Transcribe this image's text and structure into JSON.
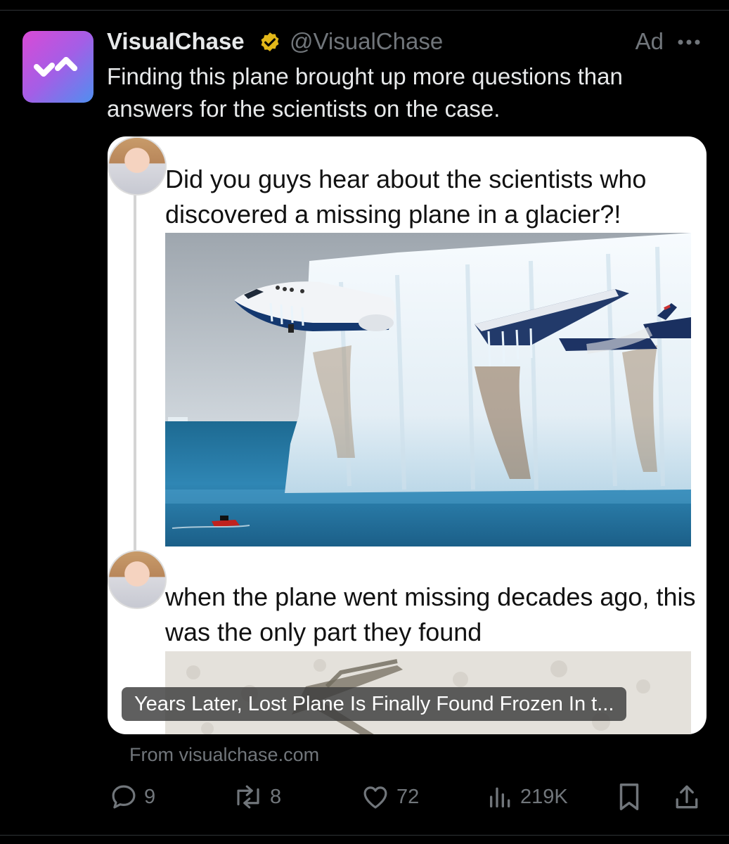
{
  "author": {
    "name": "VisualChase",
    "handle": "@VisualChase",
    "verified": true,
    "brand_gradient": [
      "#d94ad6",
      "#a45ee6",
      "#4f8ff0"
    ]
  },
  "ad_label": "Ad",
  "tweet": {
    "text": "Finding this plane brought up more questions than answers for the scientists on the case."
  },
  "card": {
    "post1_text": "Did you guys hear about the scientists who discovered a missing plane in a glacier?!",
    "post2_text": "when the plane went missing decades ago, this was the only part they found",
    "caption": "Years Later, Lost Plane Is Finally Found Frozen In t...",
    "source": "From visualchase.com"
  },
  "actions": {
    "replies": "9",
    "reposts": "8",
    "likes": "72",
    "views": "219K"
  },
  "icons": [
    "more-icon",
    "verified-badge-icon",
    "reply-icon",
    "repost-icon",
    "like-icon",
    "views-icon",
    "bookmark-icon",
    "share-icon"
  ],
  "colors": {
    "background": "#000000",
    "text_primary": "#e7e9ea",
    "text_secondary": "#71767b",
    "verified_gold": "#e2b719"
  }
}
